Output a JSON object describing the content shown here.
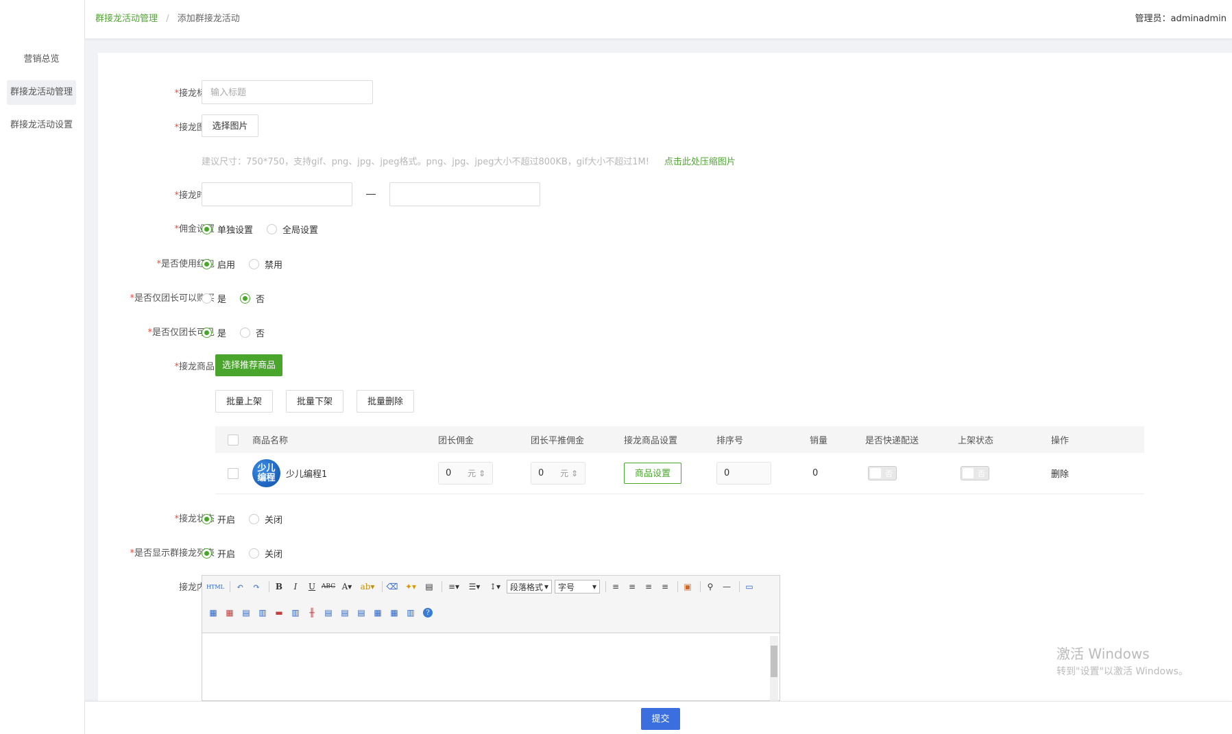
{
  "sidebar": {
    "items": [
      {
        "label": "营销总览"
      },
      {
        "label": "群接龙活动管理"
      },
      {
        "label": "群接龙活动设置"
      }
    ]
  },
  "header": {
    "breadcrumb_link": "群接龙活动管理",
    "breadcrumb_sep": "/",
    "breadcrumb_current": "添加群接龙活动",
    "admin_label": "管理员：",
    "admin_name": "adminadmin"
  },
  "form": {
    "title": {
      "label": "接龙标题",
      "placeholder": "输入标题"
    },
    "image": {
      "label": "接龙图片",
      "button": "选择图片"
    },
    "hint": "建议尺寸：750*750，支持gif、png、jpg、jpeg格式。png、jpg、jpeg大小不超过800KB，gif大小不超过1M!",
    "hint_link": "点击此处压缩图片",
    "time": {
      "label": "接龙时间",
      "separator": "—"
    },
    "commission": {
      "label": "佣金设置",
      "options": [
        "单独设置",
        "全局设置"
      ],
      "selected": 0
    },
    "red_packet": {
      "label": "是否使用红包",
      "options": [
        "启用",
        "禁用"
      ],
      "selected": 0
    },
    "leader_buy": {
      "label": "是否仅团长可以购买",
      "options": [
        "是",
        "否"
      ],
      "selected": 1
    },
    "leader_visible": {
      "label": "是否仅团长可见",
      "options": [
        "是",
        "否"
      ],
      "selected": 0
    },
    "goods": {
      "label": "接龙商品",
      "select_button": "选择推荐商品"
    },
    "batch": {
      "on": "批量上架",
      "off": "批量下架",
      "delete": "批量删除"
    },
    "status": {
      "label": "接龙状态",
      "options": [
        "开启",
        "关闭"
      ],
      "selected": 0
    },
    "show_list": {
      "label": "是否显示群接龙列表",
      "options": [
        "开启",
        "关闭"
      ],
      "selected": 0
    },
    "content": {
      "label": "接龙内容"
    },
    "required_mark": "*",
    "submit": "提交"
  },
  "table": {
    "columns": [
      "商品名称",
      "团长佣金",
      "团长平推佣金",
      "接龙商品设置",
      "排序号",
      "销量",
      "是否快递配送",
      "上架状态",
      "操作"
    ],
    "rows": [
      {
        "avatar_text_1": "少儿",
        "avatar_text_2": "编程",
        "name": "少儿编程1",
        "commission": "0",
        "commission_unit": "元",
        "flat_commission": "0",
        "flat_unit": "元",
        "settings_button": "商品设置",
        "sort": "0",
        "sales": "0",
        "express": "否",
        "shelf": "否",
        "action": "删除"
      }
    ]
  },
  "editor": {
    "paragraph_select": "段落格式",
    "font_size_select": "字号",
    "html_btn": "HTML"
  },
  "watermark": {
    "title": "激活 Windows",
    "subtitle": "转到\"设置\"以激活 Windows。"
  },
  "colors": {
    "accent_green": "#4aa52c",
    "submit_blue": "#3b6fe0",
    "required_red": "#e84c3d"
  }
}
